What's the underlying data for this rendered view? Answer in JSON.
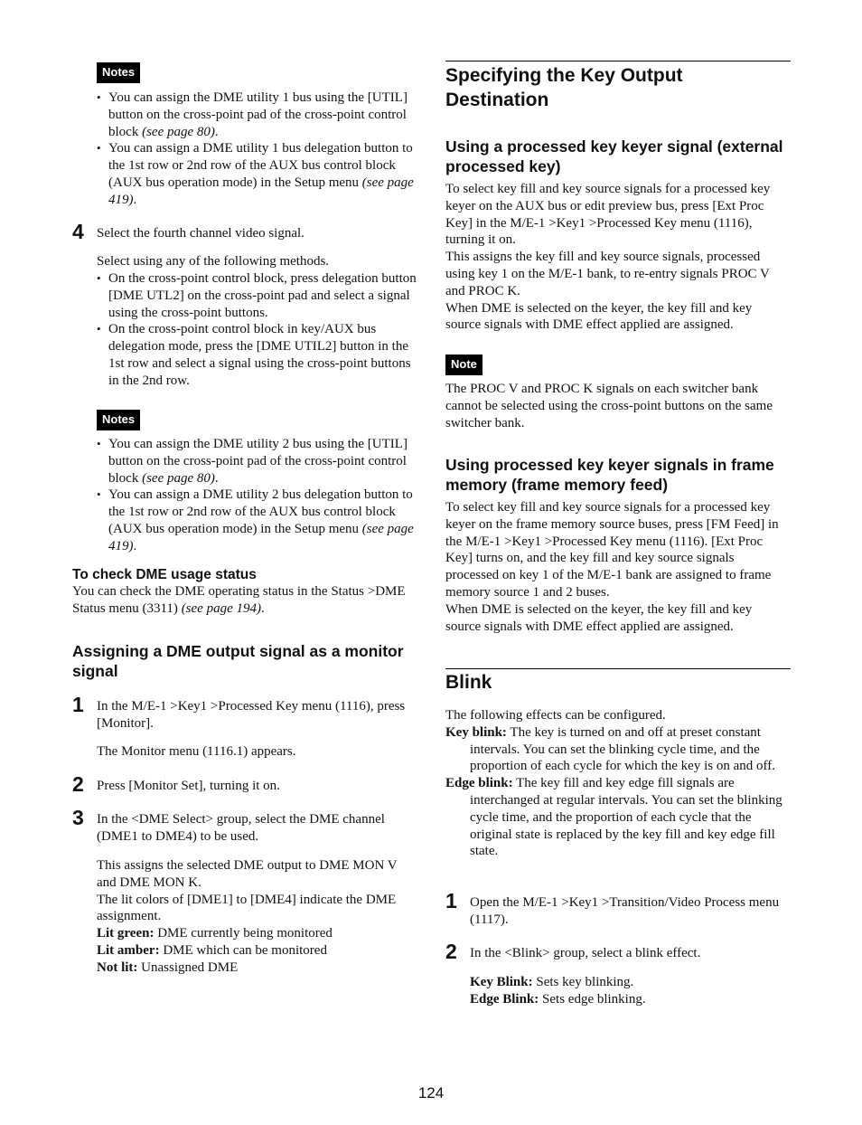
{
  "left": {
    "notes1": {
      "badge": "Notes",
      "items": [
        {
          "text": "You can assign the DME utility 1 bus using the [UTIL] button on the cross-point pad of the cross-point control block ",
          "ref": "(see page 80)",
          "end": "."
        },
        {
          "text": "You can assign a DME utility 1 bus delegation button to the 1st row or 2nd row of the AUX bus control block (AUX bus operation mode) in the Setup menu ",
          "ref": "(see page 419)",
          "end": "."
        }
      ]
    },
    "step4": {
      "number": "4",
      "text": "Select the fourth channel video signal.",
      "intro": "Select using any of the following methods.",
      "methods": [
        "On the cross-point control block, press delegation button [DME UTL2] on the cross-point pad and select a signal using the cross-point buttons.",
        "On the cross-point control block in key/AUX bus delegation mode, press the [DME UTIL2] button in the 1st row and select a signal using the cross-point buttons in the 2nd row."
      ]
    },
    "notes2": {
      "badge": "Notes",
      "items": [
        {
          "text": "You can assign the DME utility 2 bus using the [UTIL] button on the cross-point pad of the cross-point control block ",
          "ref": "(see page 80)",
          "end": "."
        },
        {
          "text": "You can assign a DME utility 2 bus delegation button to the 1st row or 2nd row of the AUX bus control block (AUX bus operation mode) in the Setup menu ",
          "ref": "(see page 419)",
          "end": "."
        }
      ]
    },
    "check_status": {
      "heading": "To check DME usage status",
      "text": "You can check the DME operating status in the Status >DME Status menu (3311) ",
      "ref": "(see page 194)",
      "end": "."
    },
    "monitor_section": {
      "heading": "Assigning a DME output signal as a monitor signal",
      "steps": [
        {
          "number": "1",
          "text": "In the M/E-1 >Key1 >Processed Key menu (1116), press [Monitor].",
          "note": "The Monitor menu (1116.1) appears."
        },
        {
          "number": "2",
          "text": "Press [Monitor Set], turning it on."
        },
        {
          "number": "3",
          "text": "In the <DME Select> group, select the DME channel (DME1 to DME4) to be used.",
          "para1": "This assigns the selected DME output to DME MON V and DME MON K.",
          "para2": "The lit colors of [DME1] to [DME4] indicate the DME assignment.",
          "definitions": [
            {
              "term": "Lit green:",
              "desc": " DME currently being monitored"
            },
            {
              "term": "Lit amber:",
              "desc": " DME which can be monitored"
            },
            {
              "term": "Not lit:",
              "desc": " Unassigned DME"
            }
          ]
        }
      ]
    }
  },
  "right": {
    "key_output": {
      "heading": "Specifying the Key Output Destination",
      "sub1": {
        "heading": "Using a processed key keyer signal (external processed key)",
        "p1": "To select key fill and key source signals for a processed key keyer on the AUX bus or edit preview bus, press [Ext Proc Key] in the M/E-1 >Key1 >Processed Key menu (1116), turning it on.",
        "p2": "This assigns the key fill and key source signals, processed using key 1 on the M/E-1 bank, to re-entry signals PROC V and PROC K.",
        "p3": "When DME is selected on the keyer, the key fill and key source signals with DME effect applied are assigned."
      },
      "note": {
        "badge": "Note",
        "text": "The PROC V and PROC K signals on each switcher bank cannot be selected using the cross-point buttons on the same switcher bank."
      },
      "sub2": {
        "heading": "Using processed key keyer signals in frame memory (frame memory feed)",
        "p1": "To select key fill and key source signals for a processed key keyer on the frame memory source buses, press [FM Feed] in the M/E-1 >Key1 >Processed Key menu (1116). [Ext Proc Key] turns on, and the key fill and key source signals processed on key 1 of the M/E-1 bank are assigned to frame memory source 1 and 2 buses.",
        "p2": "When DME is selected on the keyer, the key fill and key source signals with DME effect applied are assigned."
      }
    },
    "blink": {
      "heading": "Blink",
      "intro": "The following effects can be configured.",
      "definitions": [
        {
          "term": "Key blink:",
          "desc": " The key is turned on and off at preset constant intervals. You can set the blinking cycle time, and the proportion of each cycle for which the key is on and off."
        },
        {
          "term": "Edge blink:",
          "desc": " The key fill and key edge fill signals are interchanged at regular intervals. You can set the blinking cycle time, and the proportion of each cycle that the original state is replaced by the key fill and key edge fill state."
        }
      ],
      "steps": [
        {
          "number": "1",
          "text": "Open the M/E-1 >Key1 >Transition/Video Process menu (1117)."
        },
        {
          "number": "2",
          "text": "In the <Blink> group, select a blink effect.",
          "options": [
            {
              "term": "Key Blink:",
              "desc": " Sets key blinking."
            },
            {
              "term": "Edge Blink:",
              "desc": " Sets edge blinking."
            }
          ]
        }
      ]
    }
  },
  "footer": {
    "page_number": "124"
  }
}
